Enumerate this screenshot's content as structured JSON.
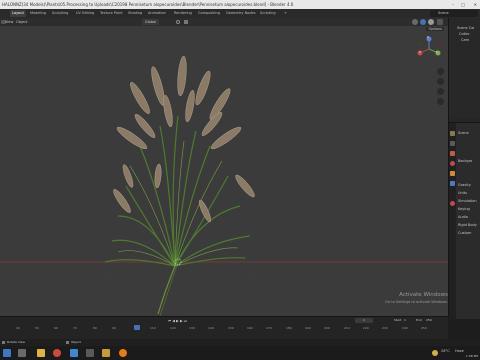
{
  "window": {
    "title": "HALONNZ(34 Models)\\Plants\\05.Processing to Uploads\\C20198 Pennisetum alopecuroides\\Blender\\Pennisetum alopecuroides.blend] - Blender 4.0"
  },
  "topbar": {
    "tabs": [
      {
        "label": "Layout",
        "active": true
      },
      {
        "label": "Modeling"
      },
      {
        "label": "Sculpting"
      },
      {
        "label": "UV Editing"
      },
      {
        "label": "Texture Paint"
      },
      {
        "label": "Shading"
      },
      {
        "label": "Animation"
      },
      {
        "label": "Rendering"
      },
      {
        "label": "Compositing"
      },
      {
        "label": "Geometry Nodes"
      },
      {
        "label": "Scripting"
      },
      {
        "label": "+"
      }
    ],
    "scene_label": "Scene"
  },
  "viewport_header": {
    "menu": [
      "View",
      "Object"
    ],
    "orientation": "Global",
    "options": "Options"
  },
  "gizmo": {
    "x": "X",
    "y": "Y",
    "z": "Z"
  },
  "outliner": {
    "items": [
      "Scene Col",
      "Collec",
      "Cam"
    ]
  },
  "properties": {
    "items": [
      "Scene",
      "Backgro",
      "Gravity",
      "Units",
      "Simulation",
      "Keying",
      "Audio",
      "Rigid Body",
      "Custom"
    ]
  },
  "timeline": {
    "frame_current": "1",
    "start_label": "Start",
    "start": "1",
    "end_label": "End",
    "end": "250",
    "ticks": [
      "40",
      "50",
      "60",
      "70",
      "80",
      "90",
      "110",
      "120",
      "130",
      "140",
      "150",
      "160",
      "170",
      "180",
      "190",
      "200",
      "210",
      "220",
      "230",
      "240",
      "250"
    ]
  },
  "status": {
    "left": "Rotate View",
    "mid": "Object"
  },
  "watermark": {
    "line1": "Activate Windows",
    "line2": "Go to Settings to activate Windows."
  },
  "taskbar": {
    "temperature": "26°C",
    "weather": "Haze",
    "time": "1:58 PM"
  },
  "colors": {
    "viewport_bg": "#3b3b3b",
    "grid_red": "#8a3a3a",
    "grass_green": "#4e7a2e",
    "plume_brown": "#8a7a66",
    "accent": "#4772b3"
  }
}
